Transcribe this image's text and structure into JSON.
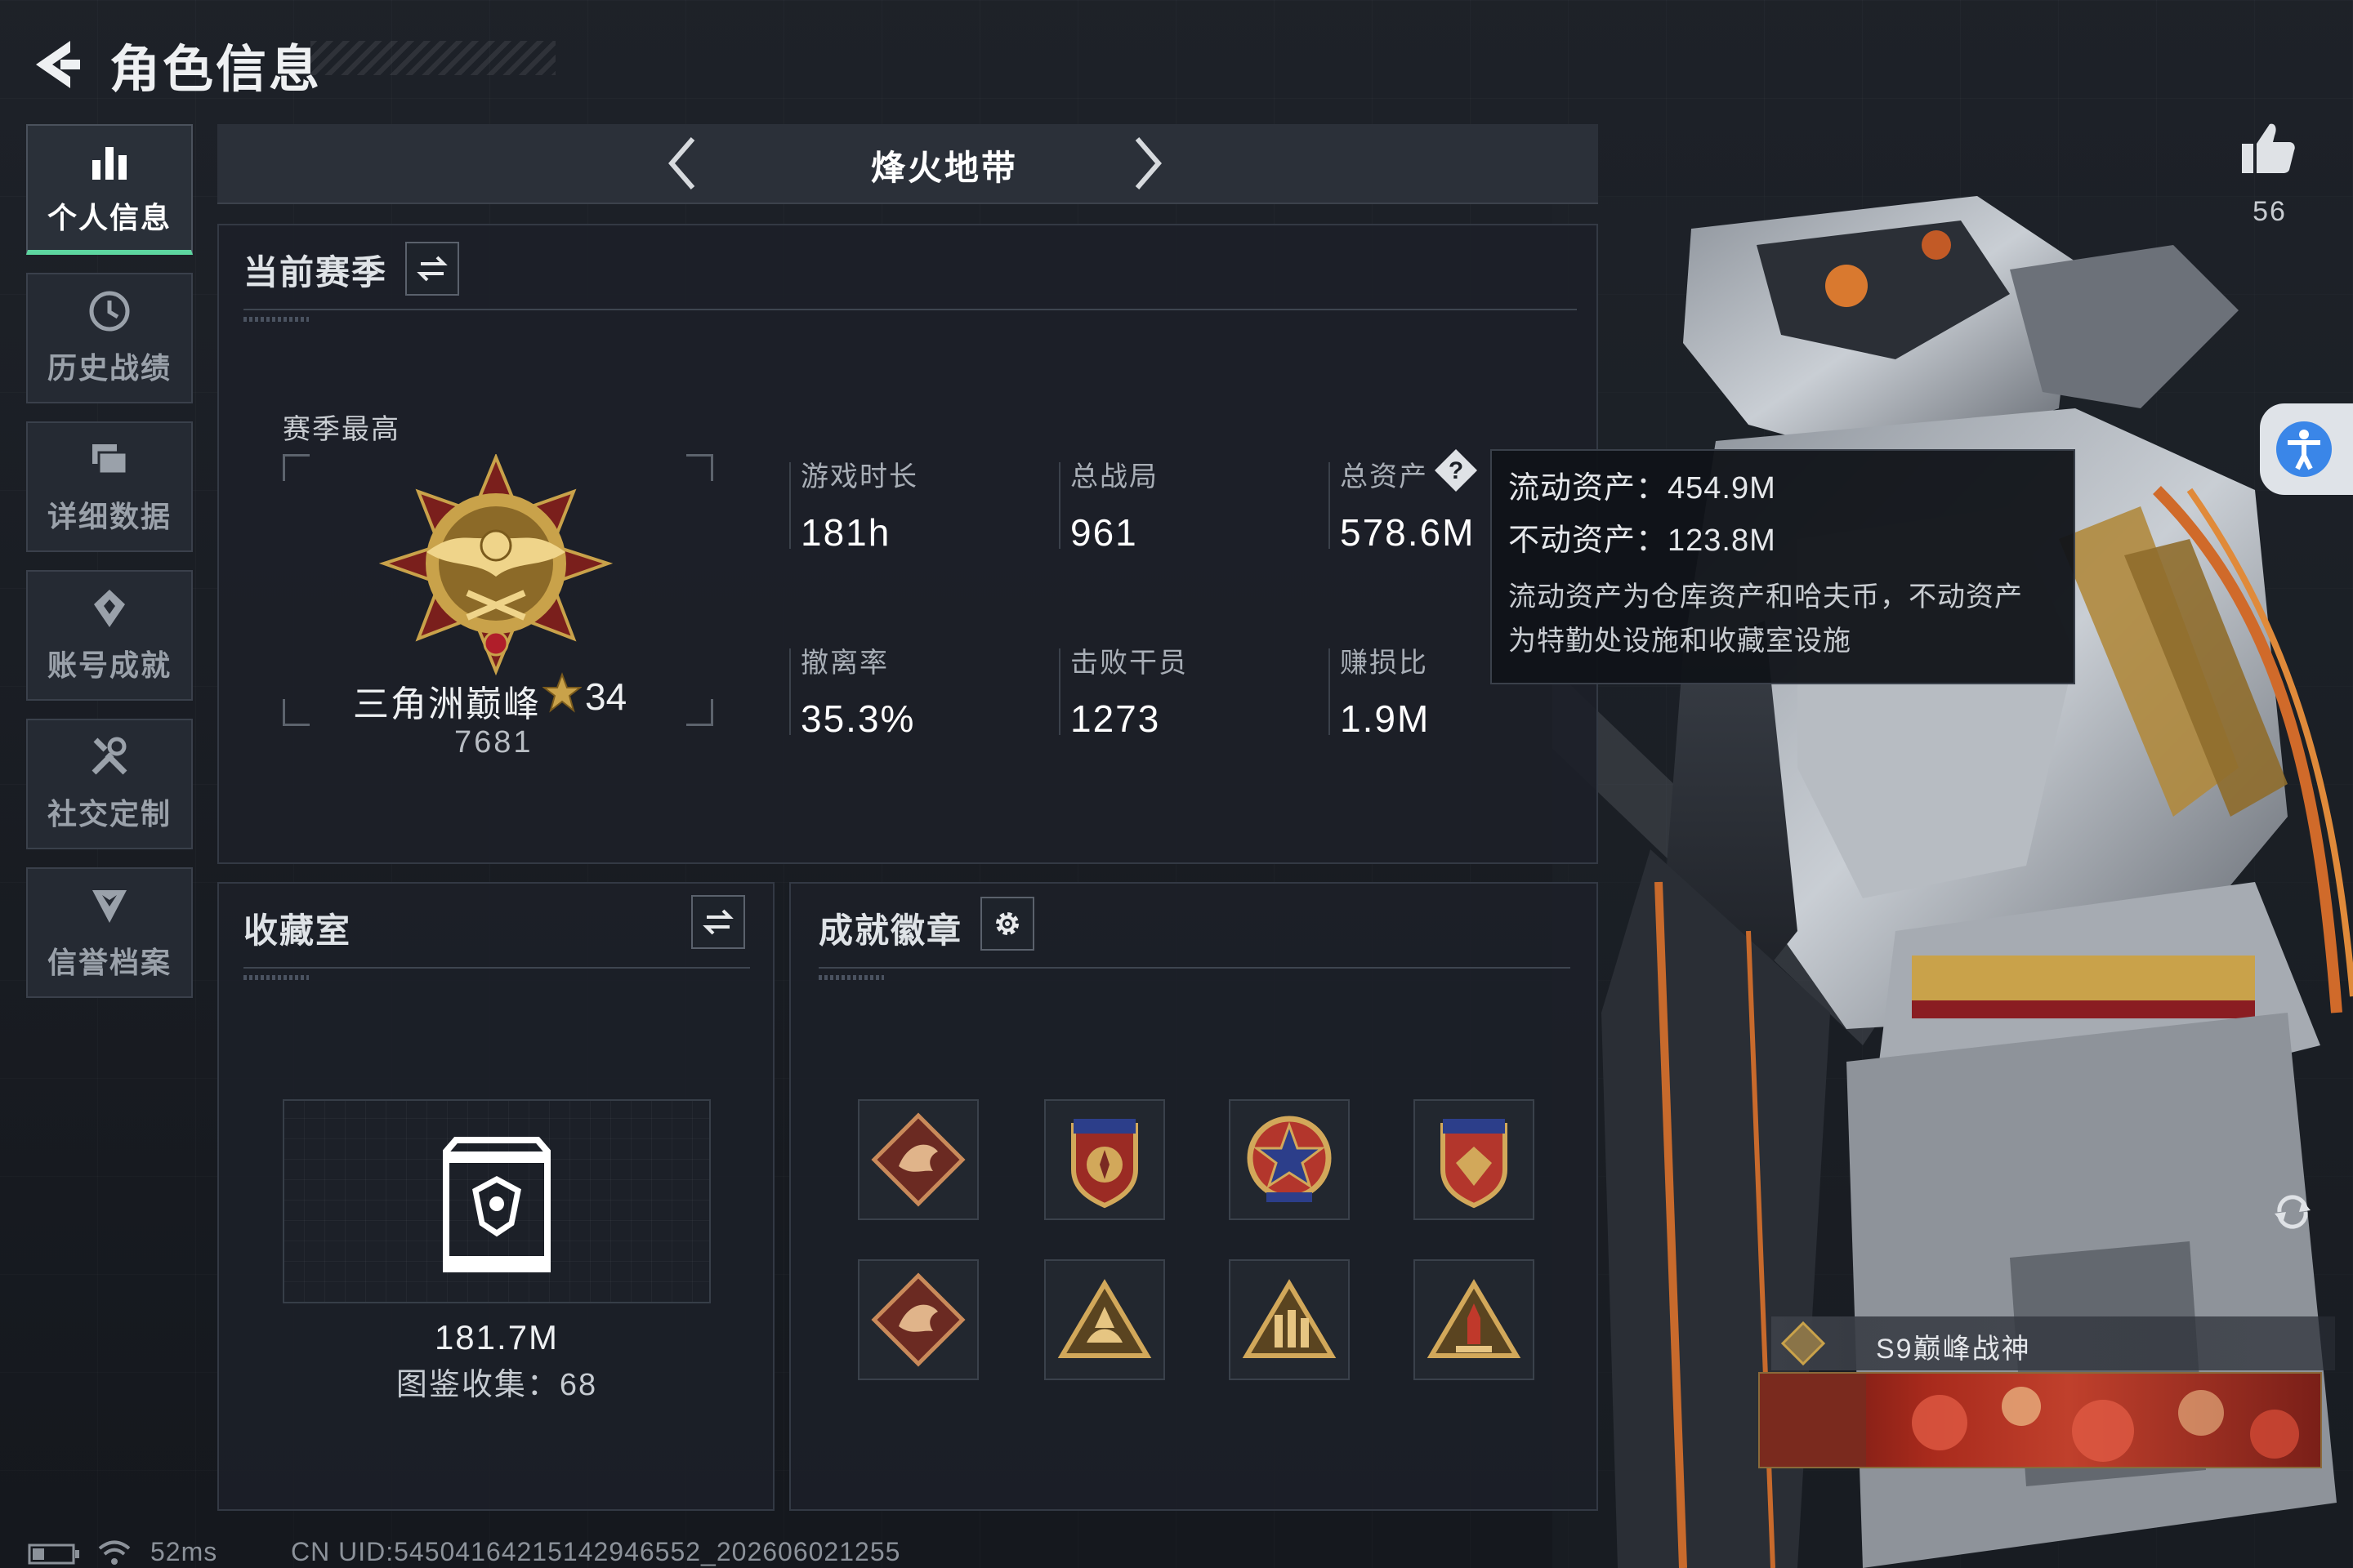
{
  "header": {
    "title": "角色信息"
  },
  "nav": {
    "items": [
      {
        "label": "个人信息",
        "icon": "bar-chart-icon",
        "active": true
      },
      {
        "label": "历史战绩",
        "icon": "history-clock-icon",
        "active": false
      },
      {
        "label": "详细数据",
        "icon": "folders-icon",
        "active": false
      },
      {
        "label": "账号成就",
        "icon": "medal-icon",
        "active": false
      },
      {
        "label": "社交定制",
        "icon": "tools-icon",
        "active": false
      },
      {
        "label": "信誉档案",
        "icon": "shield-chevron-icon",
        "active": false
      }
    ]
  },
  "tabbar": {
    "title": "烽火地带"
  },
  "season": {
    "title": "当前赛季",
    "best_label": "赛季最高",
    "rank_name": "三角洲巅峰",
    "rank_level": "34",
    "rank_score": "7681",
    "stats": [
      {
        "label": "游戏时长",
        "value": "181h"
      },
      {
        "label": "总战局",
        "value": "961"
      },
      {
        "label": "总资产",
        "value": "578.6M"
      },
      {
        "label": "撤离率",
        "value": "35.3%"
      },
      {
        "label": "击败干员",
        "value": "1273"
      },
      {
        "label": "赚损比",
        "value": "1.9M"
      }
    ]
  },
  "tooltip": {
    "liquid": "流动资产：454.9M",
    "fixed": "不动资产：123.8M",
    "desc": "流动资产为仓库资产和哈夫币，不动资产为特勤处设施和收藏室设施"
  },
  "collection": {
    "title": "收藏室",
    "value": "181.7M",
    "count_text": "图鉴收集：68"
  },
  "badges": {
    "title": "成就徽章",
    "items": [
      {
        "icon": "dragon-diamond-badge-icon"
      },
      {
        "icon": "shield-stars-badge-icon"
      },
      {
        "icon": "star-medal-badge-icon"
      },
      {
        "icon": "shield-stars-red-badge-icon"
      },
      {
        "icon": "dragon-diamond-badge-icon"
      },
      {
        "icon": "triangle-gold-badge-icon"
      },
      {
        "icon": "triangle-soldiers-badge-icon"
      },
      {
        "icon": "triangle-rocket-badge-icon"
      }
    ]
  },
  "social": {
    "likes": "56"
  },
  "card": {
    "name": "S9巅峰战神"
  },
  "status_bar": {
    "ping": "52ms",
    "uid": "CN UID:5450416421514294655­2_202606021255"
  },
  "colors": {
    "accent_green": "#5dd6a0",
    "background": "#1a1e25",
    "gold": "#c9a24a"
  }
}
